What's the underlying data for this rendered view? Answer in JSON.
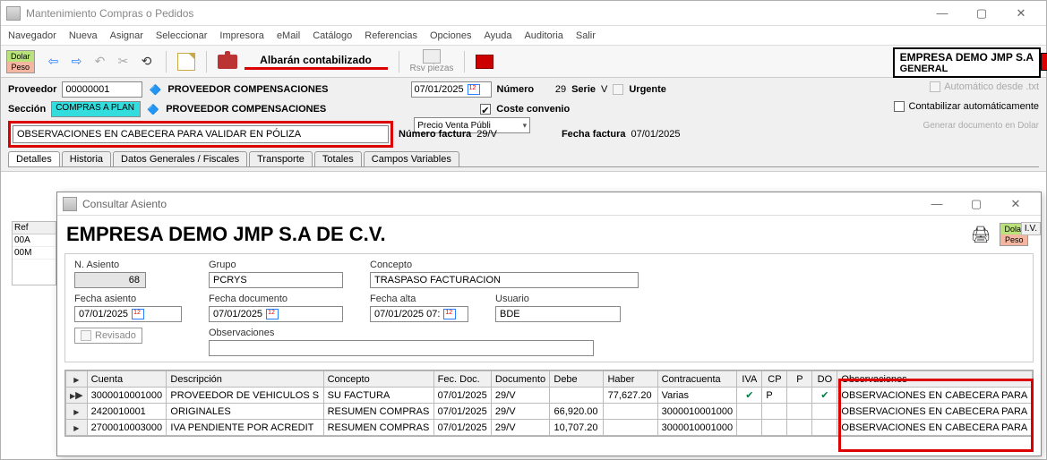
{
  "window": {
    "title": "Mantenimiento Compras o Pedidos"
  },
  "menu": [
    "Navegador",
    "Nueva",
    "Asignar",
    "Seleccionar",
    "Impresora",
    "eMail",
    "Catálogo",
    "Referencias",
    "Opciones",
    "Ayuda",
    "Auditoria",
    "Salir"
  ],
  "currency": {
    "dolar": "Dolar",
    "peso": "Peso"
  },
  "toolbar": {
    "albaran_label": "Albarán contabilizado",
    "rsv_label": "Rsv piezas"
  },
  "company": {
    "line1": "EMPRESA DEMO JMP S.A",
    "line2": "GENERAL"
  },
  "form": {
    "proveedor_label": "Proveedor",
    "proveedor_value": "00000001",
    "proveedor_name": "PROVEEDOR COMPENSACIONES",
    "seccion_label": "Sección",
    "seccion_value": "COMPRAS A PLAN",
    "seccion_name": "PROVEEDOR COMPENSACIONES",
    "fecha_label": "",
    "fecha_value": "07/01/2025",
    "numero_label": "Número",
    "numero_value": "29",
    "serie_label": "Serie",
    "serie_value": "V",
    "urgente_label": "Urgente",
    "coste_conv_label": "Coste convenio",
    "precio_select": "Precio Venta Públi",
    "auto_desde_label": "Automático desde .txt",
    "contab_auto_label": "Contabilizar automáticamente",
    "obs_cabecera": "OBSERVACIONES EN CABECERA PARA VALIDAR EN PÓLIZA",
    "num_factura_label": "Número factura",
    "num_factura_value": "29/V",
    "fecha_factura_label": "Fecha factura",
    "fecha_factura_value": "07/01/2025",
    "gen_doc_label": "Generar documento en Dolar"
  },
  "tabs": [
    "Detalles",
    "Historia",
    "Datos Generales / Fiscales",
    "Transporte",
    "Totales",
    "Campos Variables"
  ],
  "peek": {
    "header": "Ref",
    "rows": [
      "00A",
      "00M"
    ],
    "ivastub": "I.V."
  },
  "child": {
    "title": "Consultar Asiento",
    "heading": "EMPRESA DEMO JMP S.A DE C.V.",
    "fields": {
      "n_asiento_label": "N. Asiento",
      "n_asiento_value": "68",
      "grupo_label": "Grupo",
      "grupo_value": "PCRYS",
      "concepto_label": "Concepto",
      "concepto_value": "TRASPASO FACTURACION",
      "fecha_asiento_label": "Fecha asiento",
      "fecha_asiento_value": "07/01/2025",
      "fecha_doc_label": "Fecha documento",
      "fecha_doc_value": "07/01/2025",
      "fecha_alta_label": "Fecha alta",
      "fecha_alta_value": "07/01/2025 07:",
      "usuario_label": "Usuario",
      "usuario_value": "BDE",
      "revisado_label": "Revisado",
      "observaciones_label": "Observaciones",
      "observaciones_value": ""
    },
    "cols": [
      "Cuenta",
      "Descripción",
      "Concepto",
      "Fec. Doc.",
      "Documento",
      "Debe",
      "Haber",
      "Contracuenta",
      "IVA",
      "CP",
      "P",
      "DO",
      "Observaciones"
    ],
    "rows": [
      {
        "cuenta": "3000010001000",
        "desc": "PROVEEDOR DE VEHICULOS S",
        "concepto": "SU FACTURA",
        "fec": "07/01/2025",
        "docu": "29/V",
        "debe": "",
        "haber": "77,627.20",
        "contra": "Varias",
        "iva": "✔",
        "cp": "P",
        "p": "",
        "do": "✔",
        "obs": "OBSERVACIONES EN CABECERA PARA"
      },
      {
        "cuenta": "2420010001",
        "desc": "ORIGINALES",
        "concepto": "RESUMEN COMPRAS",
        "fec": "07/01/2025",
        "docu": "29/V",
        "debe": "66,920.00",
        "haber": "",
        "contra": "3000010001000",
        "iva": "",
        "cp": "",
        "p": "",
        "do": "",
        "obs": "OBSERVACIONES EN CABECERA PARA"
      },
      {
        "cuenta": "2700010003000",
        "desc": "IVA PENDIENTE POR ACREDIT",
        "concepto": "RESUMEN COMPRAS",
        "fec": "07/01/2025",
        "docu": "29/V",
        "debe": "10,707.20",
        "haber": "",
        "contra": "3000010001000",
        "iva": "",
        "cp": "",
        "p": "",
        "do": "",
        "obs": "OBSERVACIONES EN CABECERA PARA"
      }
    ]
  }
}
